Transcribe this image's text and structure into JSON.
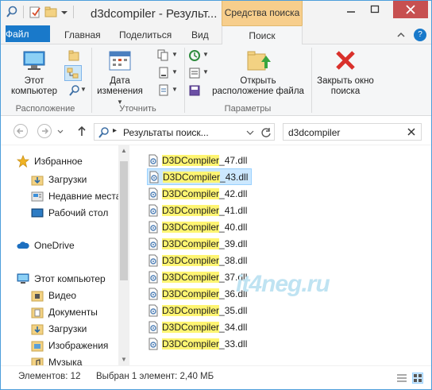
{
  "title": "d3dcompiler - Результ...",
  "context_tab_header": "Средства поиска",
  "tabs": [
    "Файл",
    "Главная",
    "Поделиться",
    "Вид",
    "Поиск"
  ],
  "ribbon": {
    "this_pc": "Этот компьютер",
    "group_location": "Расположение",
    "date_modified": "Дата изменения",
    "group_refine": "Уточнить",
    "open_location": "Открыть расположение файла",
    "group_options": "Параметры",
    "close_search": "Закрыть окно поиска"
  },
  "address": {
    "path": "Результаты поиск..."
  },
  "search": {
    "value": "d3dcompiler"
  },
  "nav": {
    "favorites": "Избранное",
    "downloads": "Загрузки",
    "recent": "Недавние места",
    "desktop": "Рабочий стол",
    "onedrive": "OneDrive",
    "this_pc": "Этот компьютер",
    "video": "Видео",
    "documents": "Документы",
    "downloads2": "Загрузки",
    "images": "Изображения",
    "music": "Музыка"
  },
  "files": [
    {
      "hl": "D3DCompiler",
      "rest": "_47.dll"
    },
    {
      "hl": "D3DCompiler",
      "rest": "_43.dll",
      "selected": true
    },
    {
      "hl": "D3DCompiler",
      "rest": "_42.dll"
    },
    {
      "hl": "D3DCompiler",
      "rest": "_41.dll"
    },
    {
      "hl": "D3DCompiler",
      "rest": "_40.dll"
    },
    {
      "hl": "D3DCompiler",
      "rest": "_39.dll"
    },
    {
      "hl": "D3DCompiler",
      "rest": "_38.dll"
    },
    {
      "hl": "D3DCompiler",
      "rest": "_37.dll"
    },
    {
      "hl": "D3DCompiler",
      "rest": "_36.dll"
    },
    {
      "hl": "D3DCompiler",
      "rest": "_35.dll"
    },
    {
      "hl": "D3DCompiler",
      "rest": "_34.dll"
    },
    {
      "hl": "D3DCompiler",
      "rest": "_33.dll"
    }
  ],
  "watermark": "it4neg.ru",
  "status": {
    "count": "Элементов: 12",
    "selected": "Выбран 1 элемент: 2,40 МБ"
  },
  "colors": {
    "accent": "#1979ca",
    "context_tab": "#f7ce8c",
    "highlight": "#fff572",
    "selection": "#cce8ff"
  }
}
